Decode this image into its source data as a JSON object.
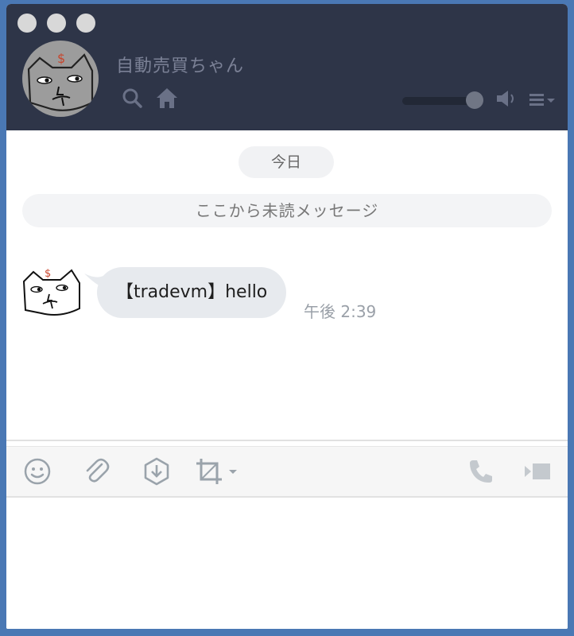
{
  "window": {
    "title": "自動売買ちゃん"
  },
  "chat": {
    "date_label": "今日",
    "unread_label": "ここから未読メッセージ",
    "messages": [
      {
        "text": "【tradevm】hello",
        "time": "午後 2:39"
      }
    ]
  },
  "colors": {
    "header_bg": "#2e3548",
    "header_icon": "#6a7187",
    "bubble_bg": "#e7eaee",
    "toolbar_icon": "#9aa3ab"
  },
  "icons": {
    "header": [
      "search-icon",
      "home-icon",
      "volume-icon",
      "menu-icon"
    ],
    "toolbar": [
      "emoji-icon",
      "attach-icon",
      "download-icon",
      "crop-icon",
      "phone-icon",
      "video-icon"
    ]
  }
}
